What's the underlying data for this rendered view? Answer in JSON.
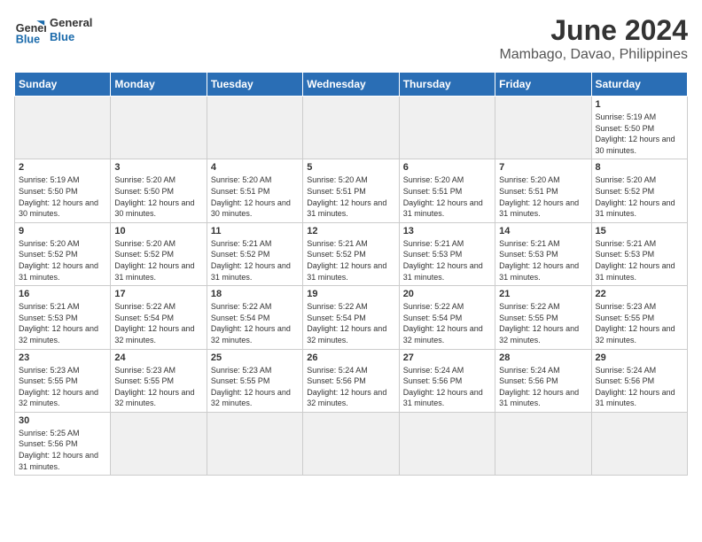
{
  "header": {
    "logo_general": "General",
    "logo_blue": "Blue",
    "title": "June 2024",
    "subtitle": "Mambago, Davao, Philippines"
  },
  "days_of_week": [
    "Sunday",
    "Monday",
    "Tuesday",
    "Wednesday",
    "Thursday",
    "Friday",
    "Saturday"
  ],
  "rows": [
    {
      "cells": [
        {
          "day": "",
          "info": "",
          "empty": true
        },
        {
          "day": "",
          "info": "",
          "empty": true
        },
        {
          "day": "",
          "info": "",
          "empty": true
        },
        {
          "day": "",
          "info": "",
          "empty": true
        },
        {
          "day": "",
          "info": "",
          "empty": true
        },
        {
          "day": "",
          "info": "",
          "empty": true
        },
        {
          "day": "1",
          "info": "Sunrise: 5:19 AM\nSunset: 5:50 PM\nDaylight: 12 hours\nand 30 minutes.",
          "empty": false
        }
      ]
    },
    {
      "cells": [
        {
          "day": "2",
          "info": "Sunrise: 5:19 AM\nSunset: 5:50 PM\nDaylight: 12 hours\nand 30 minutes.",
          "empty": false
        },
        {
          "day": "3",
          "info": "Sunrise: 5:20 AM\nSunset: 5:50 PM\nDaylight: 12 hours\nand 30 minutes.",
          "empty": false
        },
        {
          "day": "4",
          "info": "Sunrise: 5:20 AM\nSunset: 5:51 PM\nDaylight: 12 hours\nand 30 minutes.",
          "empty": false
        },
        {
          "day": "5",
          "info": "Sunrise: 5:20 AM\nSunset: 5:51 PM\nDaylight: 12 hours\nand 31 minutes.",
          "empty": false
        },
        {
          "day": "6",
          "info": "Sunrise: 5:20 AM\nSunset: 5:51 PM\nDaylight: 12 hours\nand 31 minutes.",
          "empty": false
        },
        {
          "day": "7",
          "info": "Sunrise: 5:20 AM\nSunset: 5:51 PM\nDaylight: 12 hours\nand 31 minutes.",
          "empty": false
        },
        {
          "day": "8",
          "info": "Sunrise: 5:20 AM\nSunset: 5:52 PM\nDaylight: 12 hours\nand 31 minutes.",
          "empty": false
        }
      ]
    },
    {
      "cells": [
        {
          "day": "9",
          "info": "Sunrise: 5:20 AM\nSunset: 5:52 PM\nDaylight: 12 hours\nand 31 minutes.",
          "empty": false
        },
        {
          "day": "10",
          "info": "Sunrise: 5:20 AM\nSunset: 5:52 PM\nDaylight: 12 hours\nand 31 minutes.",
          "empty": false
        },
        {
          "day": "11",
          "info": "Sunrise: 5:21 AM\nSunset: 5:52 PM\nDaylight: 12 hours\nand 31 minutes.",
          "empty": false
        },
        {
          "day": "12",
          "info": "Sunrise: 5:21 AM\nSunset: 5:52 PM\nDaylight: 12 hours\nand 31 minutes.",
          "empty": false
        },
        {
          "day": "13",
          "info": "Sunrise: 5:21 AM\nSunset: 5:53 PM\nDaylight: 12 hours\nand 31 minutes.",
          "empty": false
        },
        {
          "day": "14",
          "info": "Sunrise: 5:21 AM\nSunset: 5:53 PM\nDaylight: 12 hours\nand 31 minutes.",
          "empty": false
        },
        {
          "day": "15",
          "info": "Sunrise: 5:21 AM\nSunset: 5:53 PM\nDaylight: 12 hours\nand 31 minutes.",
          "empty": false
        }
      ]
    },
    {
      "cells": [
        {
          "day": "16",
          "info": "Sunrise: 5:21 AM\nSunset: 5:53 PM\nDaylight: 12 hours\nand 32 minutes.",
          "empty": false
        },
        {
          "day": "17",
          "info": "Sunrise: 5:22 AM\nSunset: 5:54 PM\nDaylight: 12 hours\nand 32 minutes.",
          "empty": false
        },
        {
          "day": "18",
          "info": "Sunrise: 5:22 AM\nSunset: 5:54 PM\nDaylight: 12 hours\nand 32 minutes.",
          "empty": false
        },
        {
          "day": "19",
          "info": "Sunrise: 5:22 AM\nSunset: 5:54 PM\nDaylight: 12 hours\nand 32 minutes.",
          "empty": false
        },
        {
          "day": "20",
          "info": "Sunrise: 5:22 AM\nSunset: 5:54 PM\nDaylight: 12 hours\nand 32 minutes.",
          "empty": false
        },
        {
          "day": "21",
          "info": "Sunrise: 5:22 AM\nSunset: 5:55 PM\nDaylight: 12 hours\nand 32 minutes.",
          "empty": false
        },
        {
          "day": "22",
          "info": "Sunrise: 5:23 AM\nSunset: 5:55 PM\nDaylight: 12 hours\nand 32 minutes.",
          "empty": false
        }
      ]
    },
    {
      "cells": [
        {
          "day": "23",
          "info": "Sunrise: 5:23 AM\nSunset: 5:55 PM\nDaylight: 12 hours\nand 32 minutes.",
          "empty": false
        },
        {
          "day": "24",
          "info": "Sunrise: 5:23 AM\nSunset: 5:55 PM\nDaylight: 12 hours\nand 32 minutes.",
          "empty": false
        },
        {
          "day": "25",
          "info": "Sunrise: 5:23 AM\nSunset: 5:55 PM\nDaylight: 12 hours\nand 32 minutes.",
          "empty": false
        },
        {
          "day": "26",
          "info": "Sunrise: 5:24 AM\nSunset: 5:56 PM\nDaylight: 12 hours\nand 32 minutes.",
          "empty": false
        },
        {
          "day": "27",
          "info": "Sunrise: 5:24 AM\nSunset: 5:56 PM\nDaylight: 12 hours\nand 31 minutes.",
          "empty": false
        },
        {
          "day": "28",
          "info": "Sunrise: 5:24 AM\nSunset: 5:56 PM\nDaylight: 12 hours\nand 31 minutes.",
          "empty": false
        },
        {
          "day": "29",
          "info": "Sunrise: 5:24 AM\nSunset: 5:56 PM\nDaylight: 12 hours\nand 31 minutes.",
          "empty": false
        }
      ]
    },
    {
      "cells": [
        {
          "day": "30",
          "info": "Sunrise: 5:25 AM\nSunset: 5:56 PM\nDaylight: 12 hours\nand 31 minutes.",
          "empty": false
        },
        {
          "day": "",
          "info": "",
          "empty": true
        },
        {
          "day": "",
          "info": "",
          "empty": true
        },
        {
          "day": "",
          "info": "",
          "empty": true
        },
        {
          "day": "",
          "info": "",
          "empty": true
        },
        {
          "day": "",
          "info": "",
          "empty": true
        },
        {
          "day": "",
          "info": "",
          "empty": true
        }
      ]
    }
  ]
}
